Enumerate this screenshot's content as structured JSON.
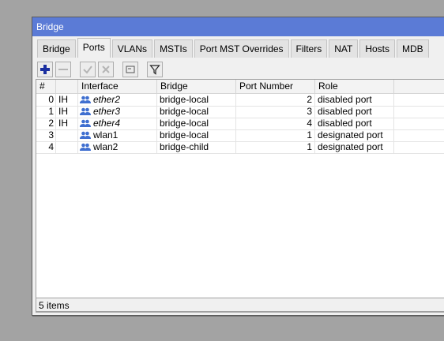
{
  "window": {
    "title": "Bridge"
  },
  "tabs": [
    {
      "label": "Bridge"
    },
    {
      "label": "Ports",
      "active": true
    },
    {
      "label": "VLANs"
    },
    {
      "label": "MSTIs"
    },
    {
      "label": "Port MST Overrides"
    },
    {
      "label": "Filters"
    },
    {
      "label": "NAT"
    },
    {
      "label": "Hosts"
    },
    {
      "label": "MDB"
    }
  ],
  "toolbar": {
    "buttons": [
      "add-icon",
      "remove-icon",
      "enable-icon",
      "disable-icon",
      "comment-icon",
      "filter-icon"
    ]
  },
  "table": {
    "columns": [
      "#",
      "",
      "Interface",
      "Bridge",
      "Port Number",
      "Role"
    ],
    "rows": [
      {
        "index": "0",
        "flags": "IH",
        "interface": "ether2",
        "bridge": "bridge-local",
        "port_number": "2",
        "role": "disabled port",
        "italic": true
      },
      {
        "index": "1",
        "flags": "IH",
        "interface": "ether3",
        "bridge": "bridge-local",
        "port_number": "3",
        "role": "disabled port",
        "italic": true
      },
      {
        "index": "2",
        "flags": "IH",
        "interface": "ether4",
        "bridge": "bridge-local",
        "port_number": "4",
        "role": "disabled port",
        "italic": true
      },
      {
        "index": "3",
        "flags": "",
        "interface": "wlan1",
        "bridge": "bridge-local",
        "port_number": "1",
        "role": "designated port",
        "italic": false
      },
      {
        "index": "4",
        "flags": "",
        "interface": "wlan2",
        "bridge": "bridge-child",
        "port_number": "1",
        "role": "designated port",
        "italic": false
      }
    ]
  },
  "status": {
    "text": "5 items"
  },
  "colors": {
    "titlebar": "#5b7bd6",
    "add_icon": "#1b2fa0",
    "interface_icon": "#3f6fd0"
  }
}
